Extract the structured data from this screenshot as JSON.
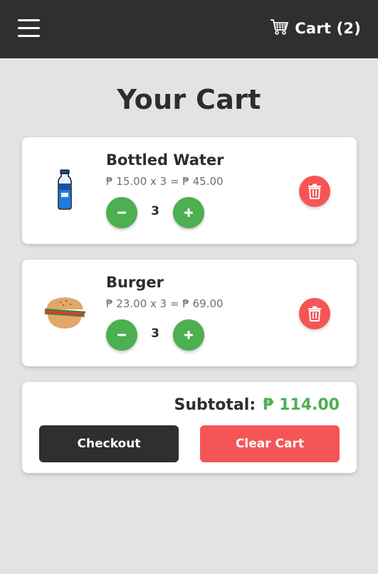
{
  "header": {
    "cart_label": "Cart (2)"
  },
  "page": {
    "title": "Your Cart"
  },
  "cart": {
    "items": [
      {
        "name": "Bottled Water",
        "price_line": "₱ 15.00 x 3 = ₱ 45.00",
        "quantity": "3",
        "icon": "water-bottle-icon"
      },
      {
        "name": "Burger",
        "price_line": "₱ 23.00 x 3 = ₱ 69.00",
        "quantity": "3",
        "icon": "burger-icon"
      }
    ],
    "subtotal_label": "Subtotal:",
    "subtotal_value": "₱ 114.00",
    "checkout_label": "Checkout",
    "clear_label": "Clear Cart"
  },
  "colors": {
    "header_bg": "#2f2f2f",
    "accent_green": "#4caf50",
    "danger_red": "#f65555",
    "page_bg": "#e3e3e3"
  }
}
